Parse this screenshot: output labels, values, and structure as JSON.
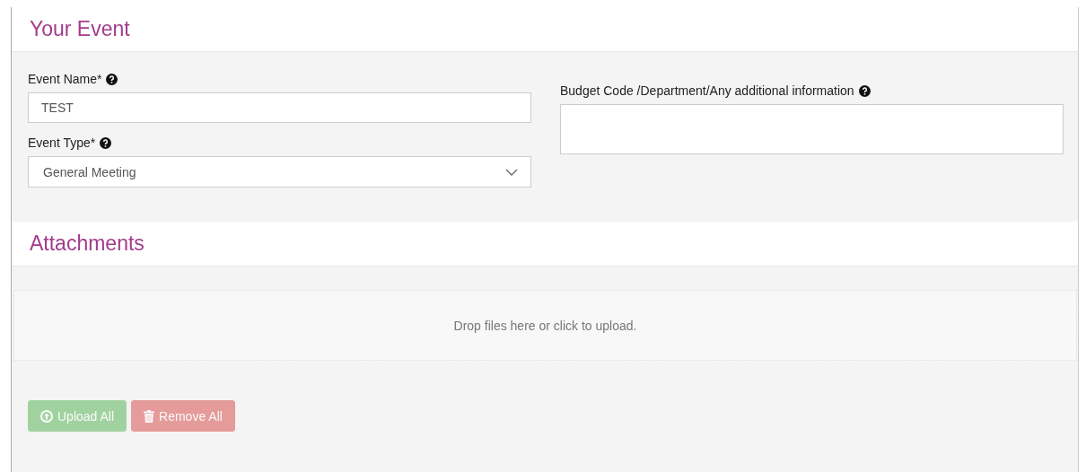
{
  "sections": [
    {
      "kind": "event",
      "title": "Your Event",
      "fields": {
        "event_name": {
          "label": "Event Name*",
          "value": "TEST"
        },
        "event_type": {
          "label": "Event Type*",
          "value": "General Meeting"
        },
        "budget": {
          "label": "Budget Code /Department/Any additional information"
        }
      }
    },
    {
      "kind": "attachments",
      "title": "Attachments",
      "dropzone": "Drop files here or click to upload.",
      "buttons": [
        {
          "kind": "upload",
          "label": "Upload All",
          "disabled": true
        },
        {
          "kind": "remove",
          "label": "Remove All",
          "disabled": true
        }
      ]
    }
  ]
}
